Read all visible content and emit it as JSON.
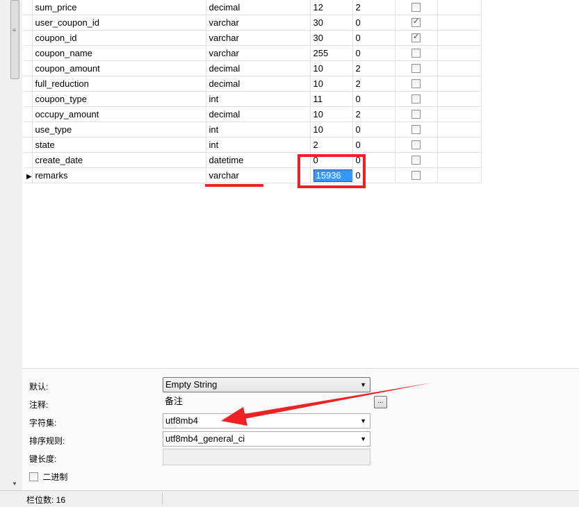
{
  "grid": {
    "rows": [
      {
        "name": "sum_price",
        "type": "decimal",
        "length": "12",
        "decimals": "2",
        "not_null": false,
        "current": false
      },
      {
        "name": "user_coupon_id",
        "type": "varchar",
        "length": "30",
        "decimals": "0",
        "not_null": true,
        "current": false
      },
      {
        "name": "coupon_id",
        "type": "varchar",
        "length": "30",
        "decimals": "0",
        "not_null": true,
        "current": false
      },
      {
        "name": "coupon_name",
        "type": "varchar",
        "length": "255",
        "decimals": "0",
        "not_null": false,
        "current": false
      },
      {
        "name": "coupon_amount",
        "type": "decimal",
        "length": "10",
        "decimals": "2",
        "not_null": false,
        "current": false
      },
      {
        "name": "full_reduction",
        "type": "decimal",
        "length": "10",
        "decimals": "2",
        "not_null": false,
        "current": false
      },
      {
        "name": "coupon_type",
        "type": "int",
        "length": "11",
        "decimals": "0",
        "not_null": false,
        "current": false
      },
      {
        "name": "occupy_amount",
        "type": "decimal",
        "length": "10",
        "decimals": "2",
        "not_null": false,
        "current": false
      },
      {
        "name": "use_type",
        "type": "int",
        "length": "10",
        "decimals": "0",
        "not_null": false,
        "current": false
      },
      {
        "name": "state",
        "type": "int",
        "length": "2",
        "decimals": "0",
        "not_null": false,
        "current": false
      },
      {
        "name": "create_date",
        "type": "datetime",
        "length": "0",
        "decimals": "0",
        "not_null": false,
        "current": false
      },
      {
        "name": "remarks",
        "type": "varchar",
        "length": "15936",
        "decimals": "0",
        "not_null": false,
        "current": true
      }
    ],
    "current_row_icon": "row-pointer-icon",
    "check_icon": "check-icon"
  },
  "properties": {
    "default_label": "默认:",
    "default_value": "Empty String",
    "comment_label": "注释:",
    "comment_value": "备注",
    "ellipsis_label": "...",
    "charset_label": "字符集:",
    "charset_value": "utf8mb4",
    "collation_label": "排序规则:",
    "collation_value": "utf8mb4_general_ci",
    "key_length_label": "键长度:",
    "key_length_value": "",
    "binary_label": "二进制",
    "binary_checked": false
  },
  "status": {
    "column_count": "栏位数: 16"
  },
  "annotation_color": "#ee2222",
  "selection_color": "#3399ff"
}
